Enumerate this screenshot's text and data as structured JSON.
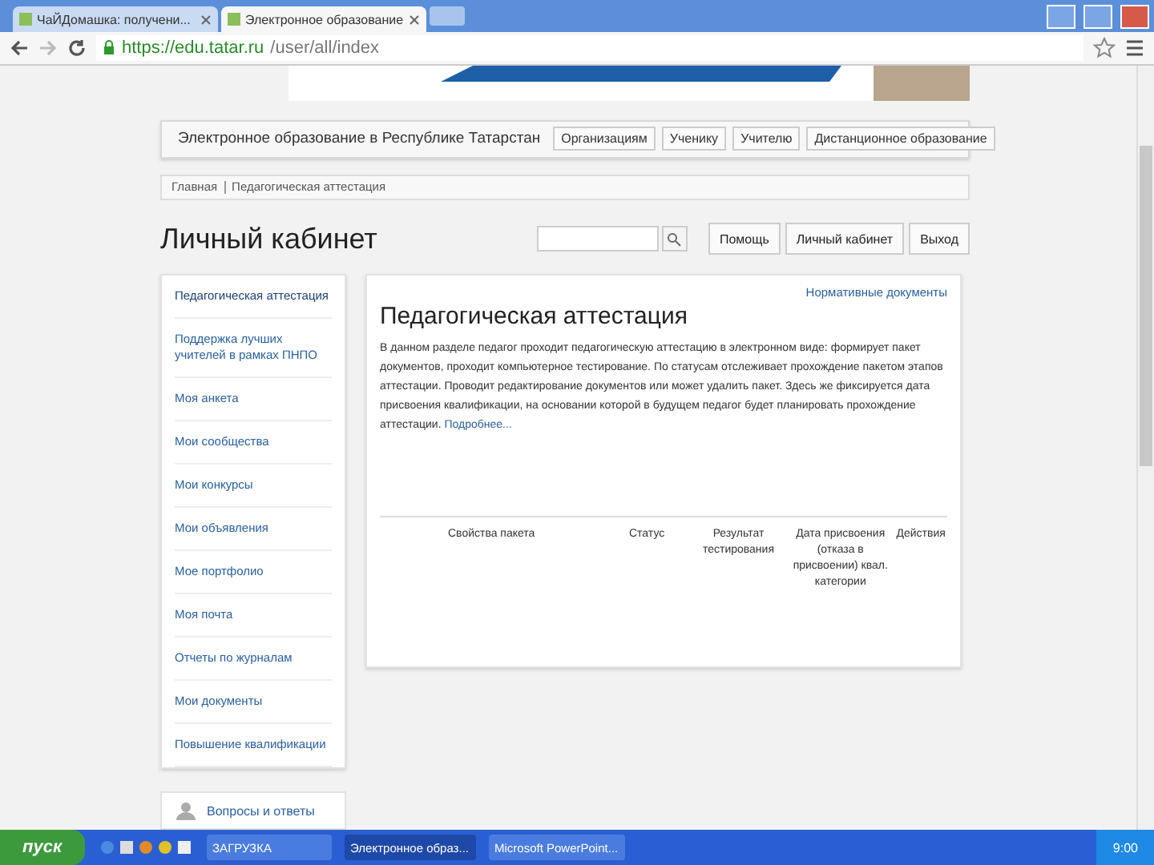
{
  "browser": {
    "tabs": [
      {
        "label": "ЧаЙДомашка: получени...",
        "selected": false
      },
      {
        "label": "Электронное образование",
        "selected": true
      }
    ],
    "url_host": "https://edu.tatar.ru",
    "url_path": "/user/all/index"
  },
  "header": {
    "site_title": "Электронное образование в Республике Татарстан",
    "nav": [
      "Организациям",
      "Ученику",
      "Учителю",
      "Дистанционное образование"
    ]
  },
  "breadcrumbs": [
    "Главная",
    "Педагогическая аттестация"
  ],
  "page_title": "Личный кабинет",
  "top_buttons": [
    "Помощь",
    "Личный кабинет",
    "Выход"
  ],
  "sidebar": {
    "items": [
      {
        "label": "Педагогическая аттестация",
        "selected": true
      },
      {
        "label": "Поддержка лучших учителей в рамках ПНПО",
        "selected": false
      },
      {
        "label": "Моя анкета",
        "selected": false
      },
      {
        "label": "Мои сообщества",
        "selected": false
      },
      {
        "label": "Мои конкурсы",
        "selected": false
      },
      {
        "label": "Мои объявления",
        "selected": false
      },
      {
        "label": "Мое портфолио",
        "selected": false
      },
      {
        "label": "Моя почта",
        "selected": false
      },
      {
        "label": "Отчеты по журналам",
        "selected": false
      },
      {
        "label": "Мои документы",
        "selected": false
      },
      {
        "label": "Повышение квалификации",
        "selected": false
      }
    ],
    "extra": "Вопросы и ответы"
  },
  "main": {
    "docs_link": "Нормативные документы",
    "title": "Педагогическая аттестация",
    "text": "В данном разделе педагог проходит педагогическую аттестацию в электронном виде: формирует пакет документов, проходит компьютерное тестирование. По статусам отслеживает прохождение пакетом этапов аттестации. Проводит редактирование документов или может удалить пакет. Здесь же фиксируется дата присвоения квалификации, на основании которой в будущем педагог будет планировать прохождение аттестации.",
    "more": "Подробнее...",
    "table": {
      "columns": [
        "Свойства пакета",
        "Статус",
        "Результат тестирования",
        "Дата присвоения (отказа в присвоении) квал. категории",
        "Действия"
      ]
    }
  },
  "taskbar": {
    "start": "пуск",
    "tasks": [
      {
        "label": "ЗАГРУЗКА",
        "selected": false
      },
      {
        "label": "Электронное образ...",
        "selected": true
      },
      {
        "label": "Microsoft PowerPoint...",
        "selected": false
      }
    ],
    "clock": "9:00"
  }
}
